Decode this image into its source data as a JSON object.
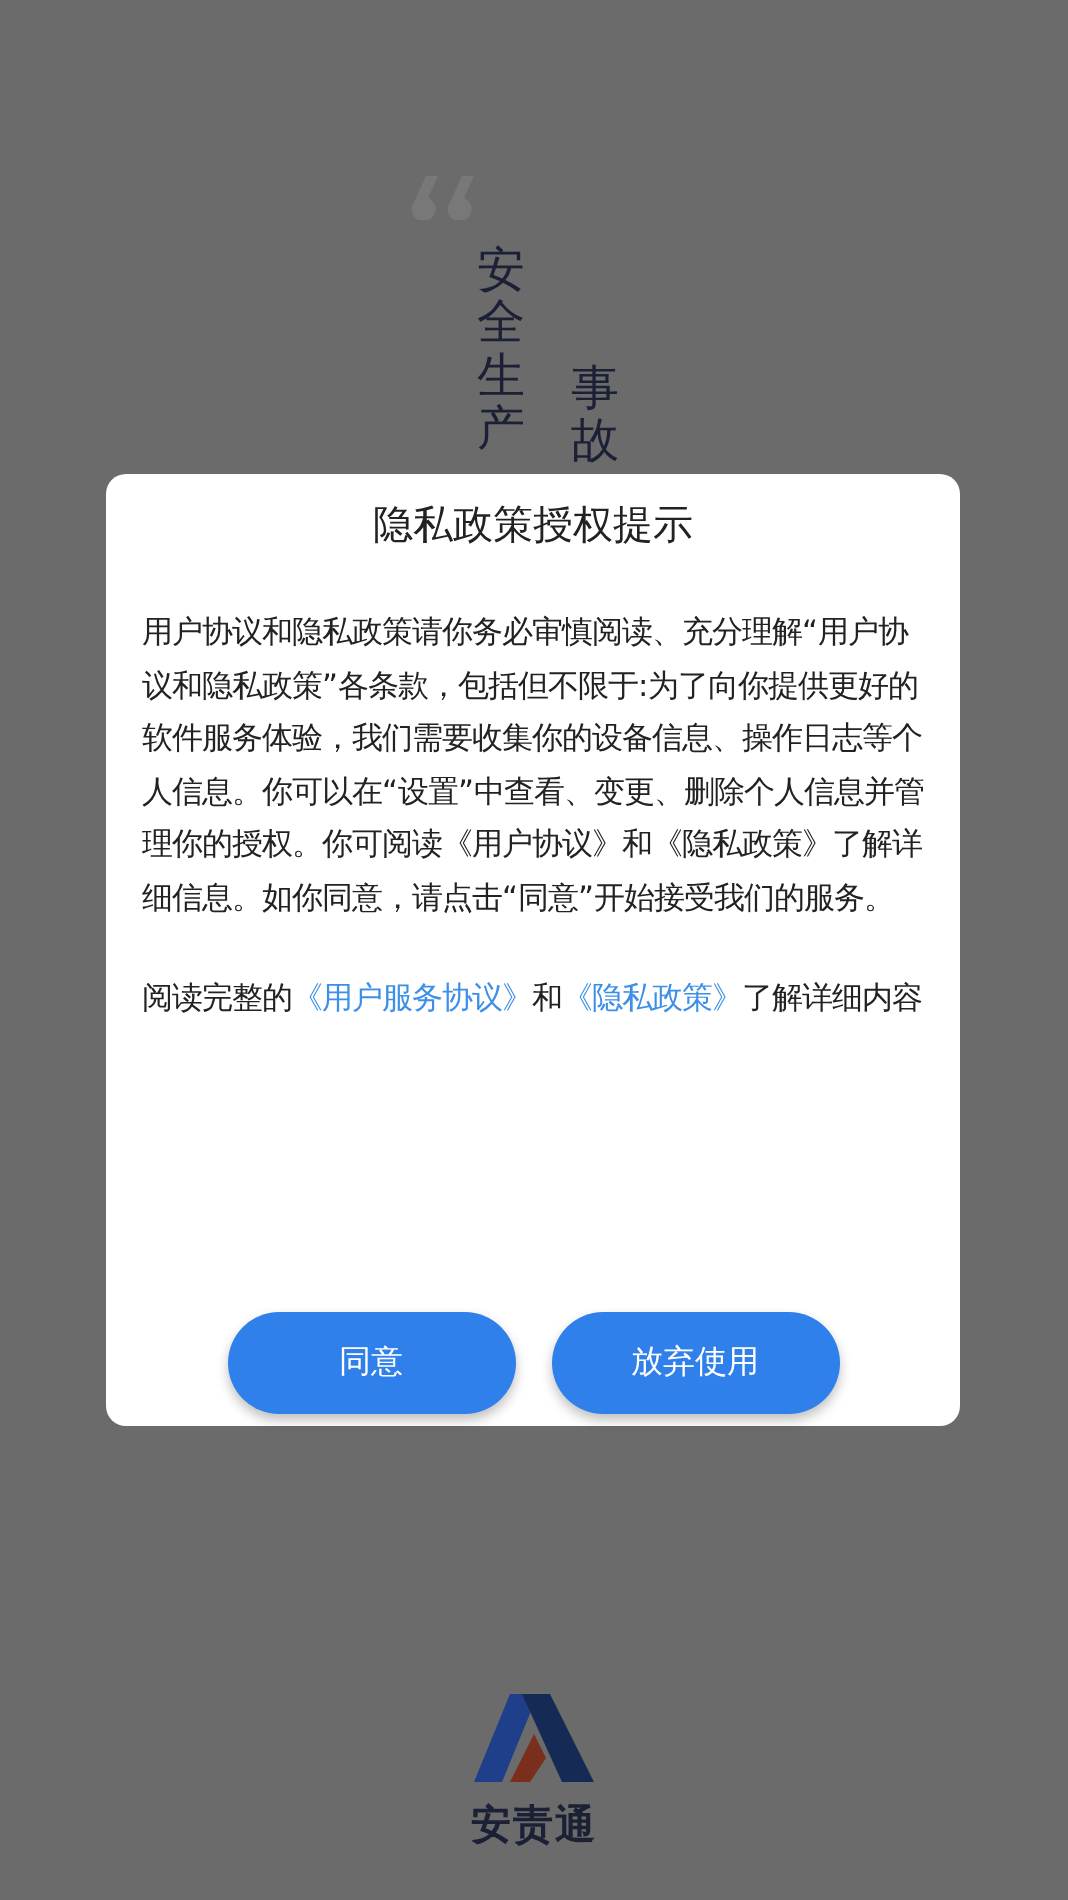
{
  "background": {
    "columns": [
      "安全生产",
      "事故"
    ],
    "app_name": "安责通"
  },
  "dialog": {
    "title": "隐私政策授权提示",
    "body": "用户协议和隐私政策请你务必审慎阅读、充分理解“用户协议和隐私政策”各条款，包括但不限于:为了向你提供更好的软件服务体验，我们需要收集你的设备信息、操作日志等个人信息。你可以在“设置”中查看、变更、删除个人信息并管理你的授权。你可阅读《用户协议》和《隐私政策》了解详细信息。如你同意，请点击“同意”开始接受我们的服务。",
    "read_more": [
      {
        "kind": "text",
        "text": "阅读完整的"
      },
      {
        "kind": "link",
        "text": "《用户服务协议》"
      },
      {
        "kind": "text",
        "text": "和"
      },
      {
        "kind": "link",
        "text": "《隐私政策》"
      },
      {
        "kind": "text",
        "text": "了解详细内容"
      }
    ],
    "buttons": [
      "同意",
      "放弃使用"
    ]
  }
}
